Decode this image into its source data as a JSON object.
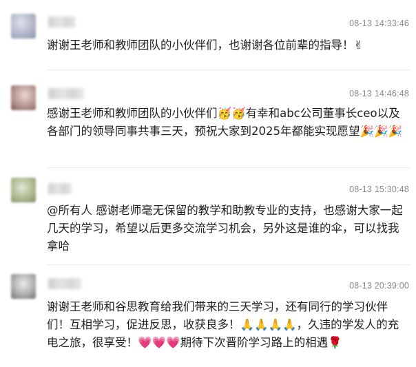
{
  "comments": [
    {
      "avatar_colors": [
        "#c9ccd6",
        "#9aa0b4"
      ],
      "time": "08-13 14:33:46",
      "text": "谢谢王老师和教师团队的小伙伴们，也谢谢各位前辈的指导！✌"
    },
    {
      "avatar_colors": [
        "#d8c6bf",
        "#8b6a60"
      ],
      "time": "08-13 14:46:48",
      "text": "感谢王老师和教师团队的小伙伴们🥳🥳有幸和abc公司董事长ceo以及各部门的领导同事共事三天，预祝大家到2025年都能实现愿望🎉🎉🎉"
    },
    {
      "avatar_colors": [
        "#c8cfb5",
        "#8d9a6b"
      ],
      "time": "08-13 15:30:48",
      "text": "@所有人 感谢老师毫无保留的教学和助教专业的支持，也感谢大家一起几天的学习，希望以后更多交流学习机会，另外这是谁的伞，可以找我拿哈"
    },
    {
      "avatar_colors": [
        "#cfcfcf",
        "#7c7c7c"
      ],
      "time": "08-13 20:39:00",
      "text": "谢谢王老师和谷思教育给我们带来的三天学习，还有同行的学习伙伴们！互相学习，促进反思，收获良多！🙏🙏🙏🙏，久违的学发人的充电之旅，很享受！💗💗💗期待下次晋阶学习路上的相遇🌹"
    }
  ]
}
